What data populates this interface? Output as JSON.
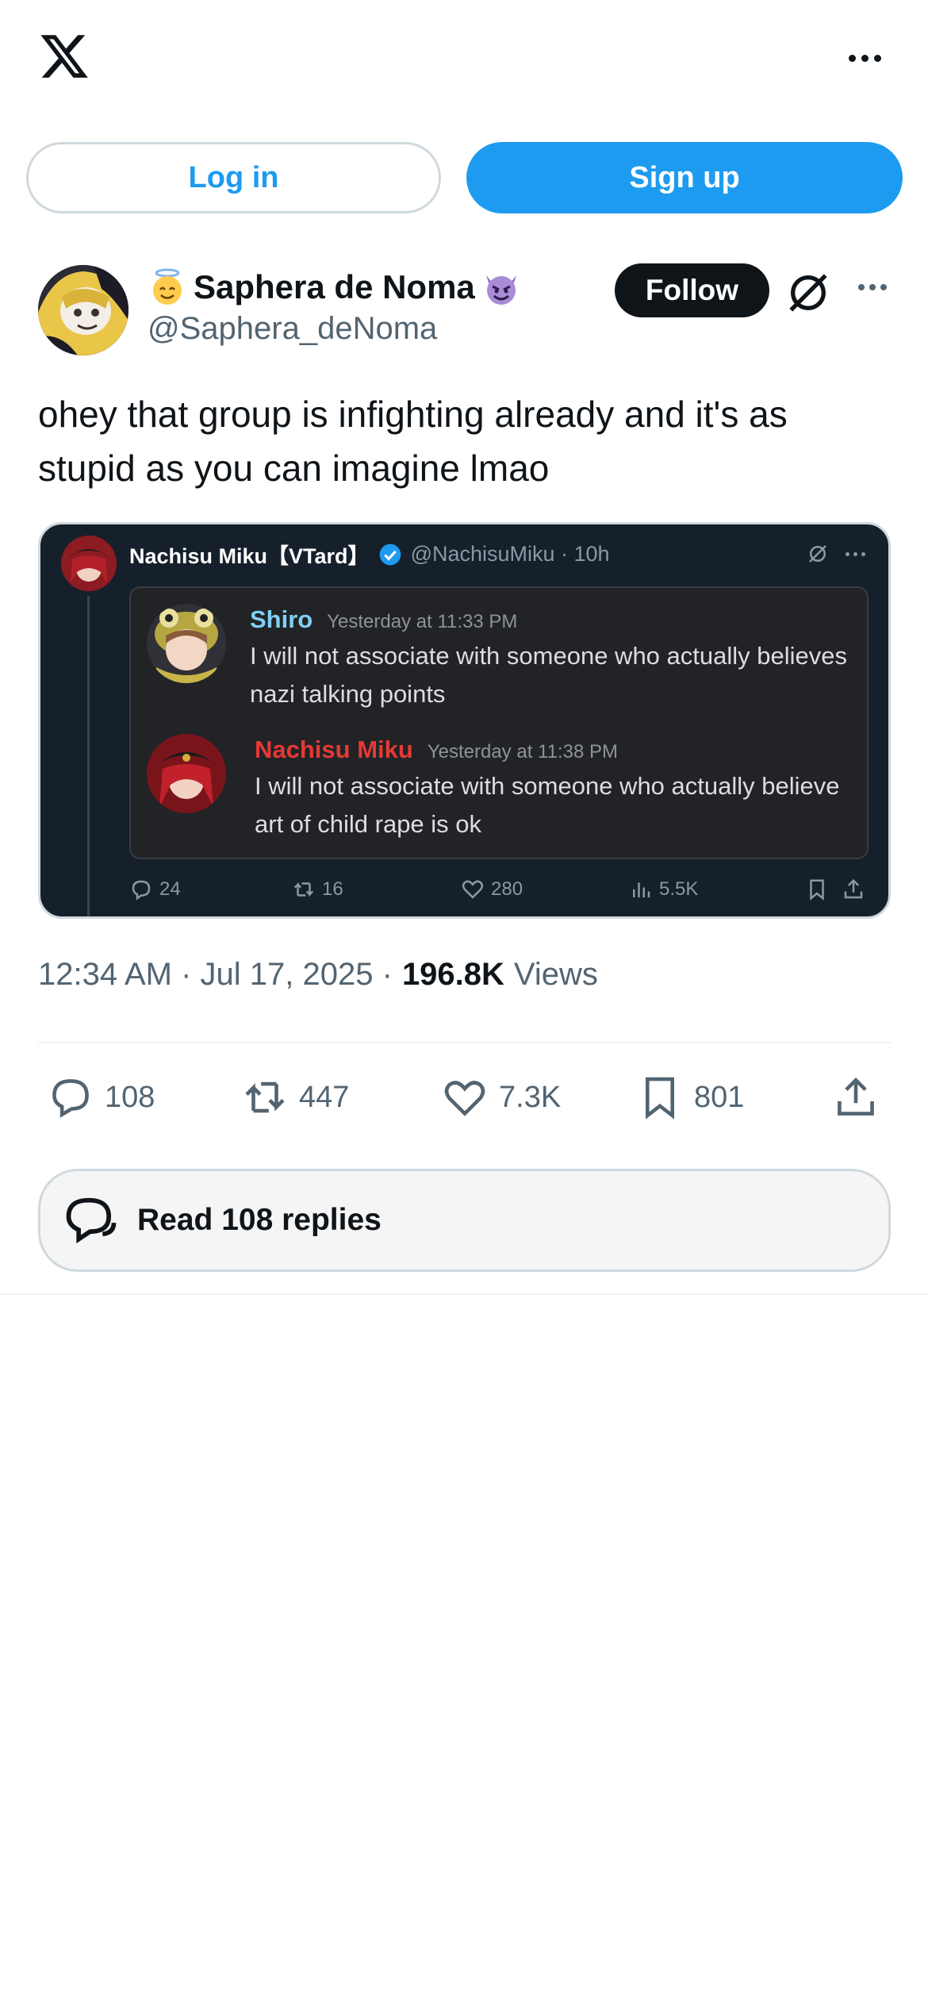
{
  "header": {
    "logo_icon": "x-logo-icon",
    "more_icon": "more-horizontal-icon"
  },
  "auth": {
    "login_label": "Log in",
    "signup_label": "Sign up"
  },
  "author": {
    "prefix_emoji": "angel-emoji",
    "display_name": "Saphera de Noma",
    "suffix_emoji": "devil-emoji",
    "handle": "@Saphera_deNoma",
    "follow_label": "Follow",
    "grok_icon": "grok-icon",
    "more_icon": "more-horizontal-icon"
  },
  "tweet": {
    "text": "ohey that group is infighting already and it's as stupid as you can imagine lmao"
  },
  "quoted_image": {
    "name": "Nachisu Miku【VTard】",
    "handle_time": "@NachisuMiku · 10h",
    "verified_icon": "verified-badge-icon",
    "messages": [
      {
        "user": "Shiro",
        "time": "Yesterday at 11:33 PM",
        "text": "I will not associate with someone who actually believes nazi talking points"
      },
      {
        "user": "Nachisu Miku",
        "time": "Yesterday at 11:38 PM",
        "text": "I will not associate with someone who actually believe art of child rape is ok"
      }
    ],
    "actions": {
      "replies": "24",
      "reposts": "16",
      "likes": "280",
      "views": "5.5K"
    }
  },
  "meta": {
    "time_date": "12:34 AM · Jul 17, 2025 ·",
    "views_count": "196.8K",
    "views_label": "Views"
  },
  "actions": {
    "replies": "108",
    "reposts": "447",
    "likes": "7.3K",
    "bookmarks": "801"
  },
  "read_replies": {
    "label": "Read 108 replies"
  },
  "colors": {
    "accent": "#1d9bf0",
    "text": "#0f1419",
    "secondary": "#536471",
    "border": "#cfd9de"
  }
}
